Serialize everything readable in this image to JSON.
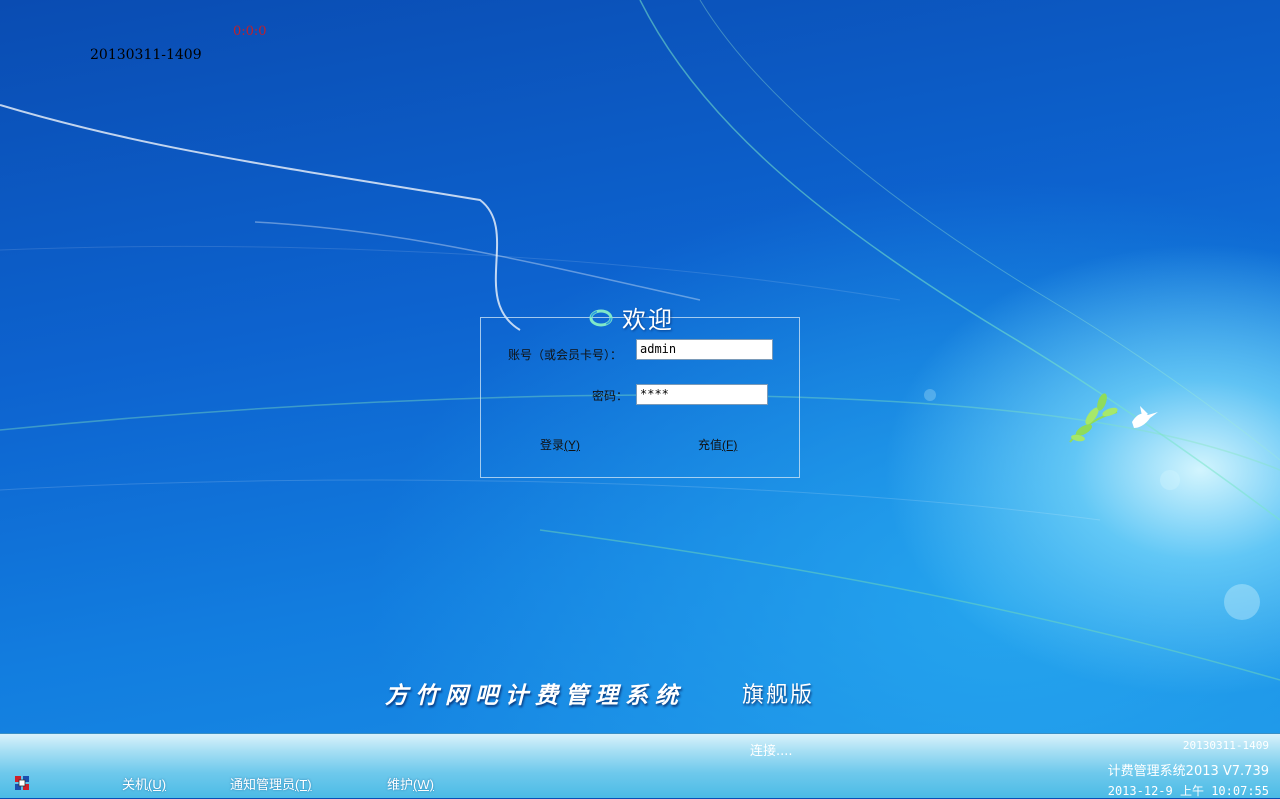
{
  "overlay": {
    "timer": "0:0:0",
    "version_code": "20130311-1409"
  },
  "login": {
    "welcome": "欢迎",
    "account_label": "账号（或会员卡号）：",
    "account_value": "admin",
    "password_label": "密码：",
    "password_value": "****",
    "login_button": "登录",
    "login_key": "(Y)",
    "recharge_button": "充值",
    "recharge_key": "(F)"
  },
  "branding": {
    "title": "方竹网吧计费管理系统",
    "edition": "旗舰版"
  },
  "taskbar": {
    "shutdown": "关机",
    "shutdown_key": "(U)",
    "notify_admin": "通知管理员",
    "notify_admin_key": "(T)",
    "maintenance": "维护",
    "maintenance_key": "(W)",
    "status": "连接....",
    "version_code": "20130311-1409",
    "system_name": "计费管理系统2013 V7.739",
    "datetime": "2013-12-9 上午 10:07:55"
  },
  "icons": {
    "welcome": "refresh-ring-icon",
    "app": "app-logo-icon",
    "bird": "dove-branch-icon"
  },
  "colors": {
    "accent_blue": "#0d63cf",
    "timer_red": "#c0202a",
    "taskbar": "#6fc9ec"
  }
}
